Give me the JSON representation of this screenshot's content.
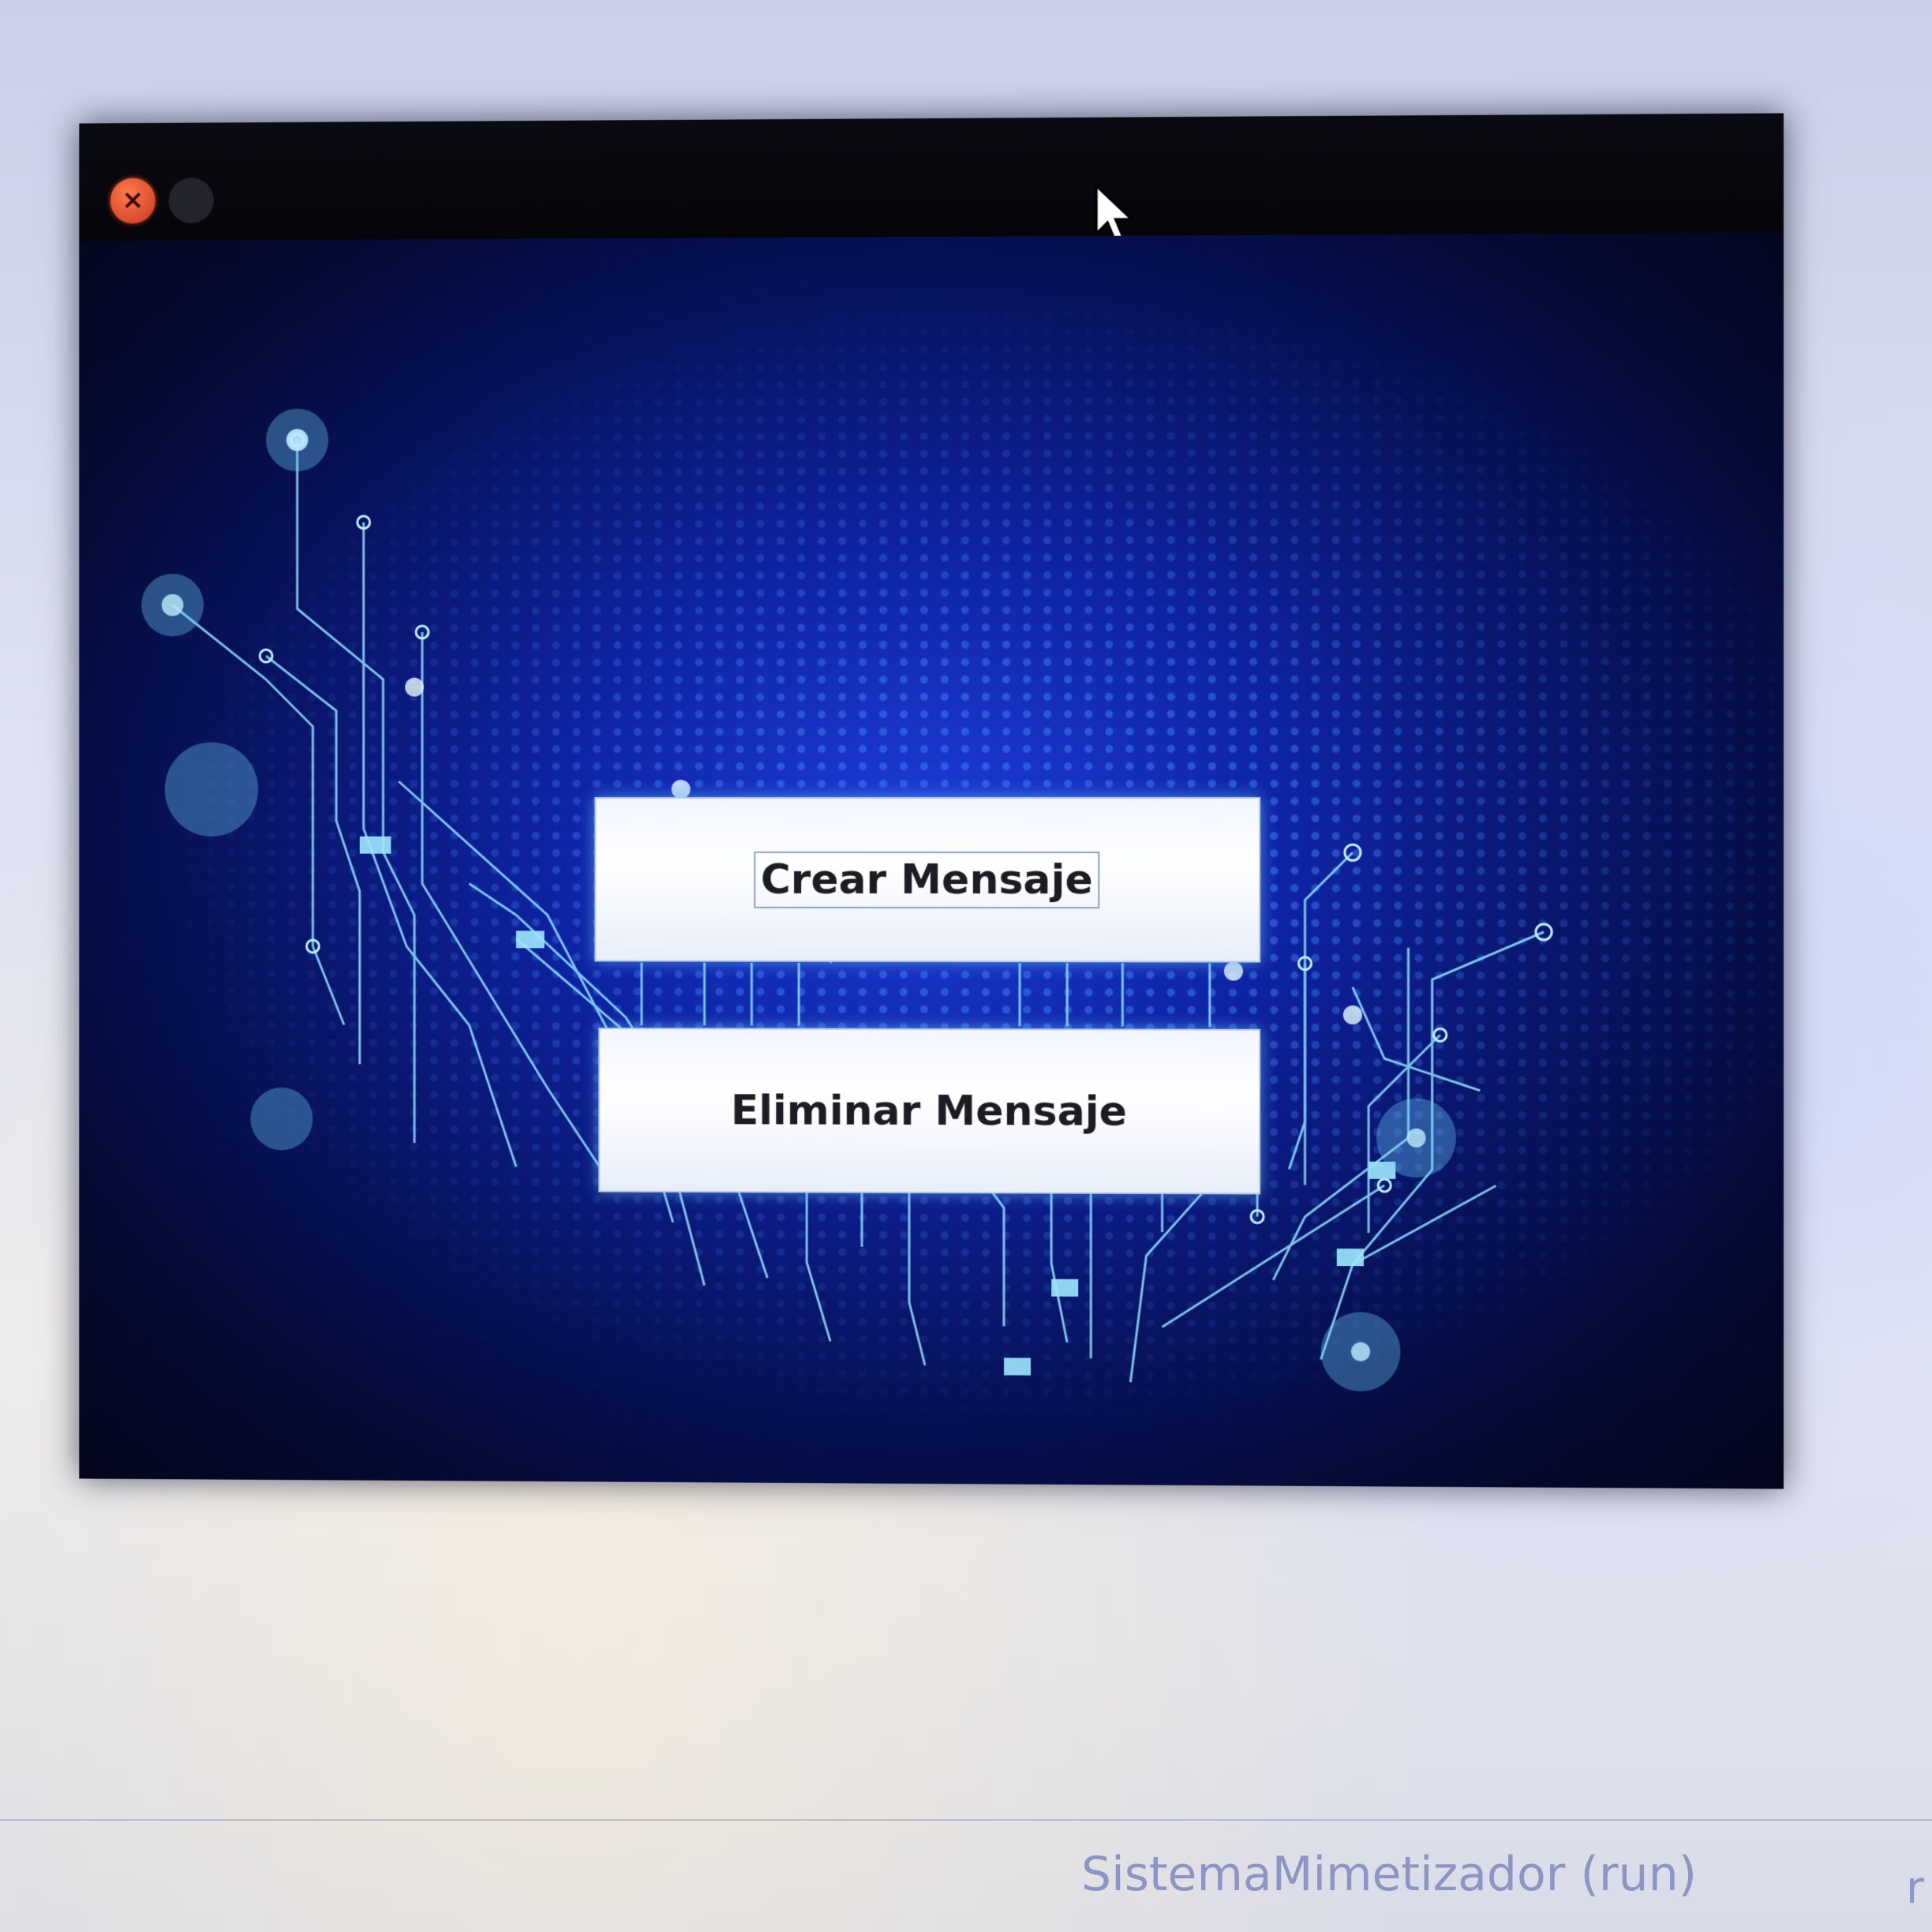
{
  "window": {
    "close_label": "×"
  },
  "buttons": {
    "create_message": "Crear Mensaje",
    "delete_message": "Eliminar Mensaje"
  },
  "statusbar": {
    "run_text": "SistemaMimetizador (run)",
    "trailing_text": "r"
  },
  "colors": {
    "background_blue": "#0f24a6",
    "circuit_cyan": "#8fe0ff",
    "button_face": "#ffffff"
  }
}
